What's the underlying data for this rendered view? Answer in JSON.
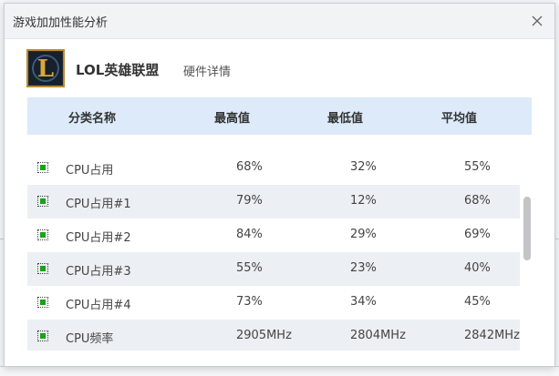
{
  "dialog": {
    "title": "游戏加加性能分析",
    "close_glyph": "×"
  },
  "game": {
    "logo_letter": "L",
    "name": "LOL英雄联盟",
    "subtitle": "硬件详情"
  },
  "table": {
    "headers": {
      "category": "分类名称",
      "max": "最高值",
      "min": "最低值",
      "avg": "平均值"
    },
    "rows": [
      {
        "name": "CPU占用",
        "max": "68%",
        "min": "32%",
        "avg": "55%",
        "checked": true
      },
      {
        "name": "CPU占用#1",
        "max": "79%",
        "min": "12%",
        "avg": "68%",
        "checked": true
      },
      {
        "name": "CPU占用#2",
        "max": "84%",
        "min": "29%",
        "avg": "69%",
        "checked": true
      },
      {
        "name": "CPU占用#3",
        "max": "55%",
        "min": "23%",
        "avg": "40%",
        "checked": true
      },
      {
        "name": "CPU占用#4",
        "max": "73%",
        "min": "34%",
        "avg": "45%",
        "checked": true
      },
      {
        "name": "CPU频率",
        "max": "2905MHz",
        "min": "2804MHz",
        "avg": "2842MHz",
        "checked": true
      }
    ]
  },
  "colors": {
    "header_bg": "#dceaf9",
    "alt_row_bg": "#eceff3",
    "checkbox_fill": "#1aa21a",
    "logo_border": "#b98b2a",
    "logo_letter": "#d9a93a"
  }
}
